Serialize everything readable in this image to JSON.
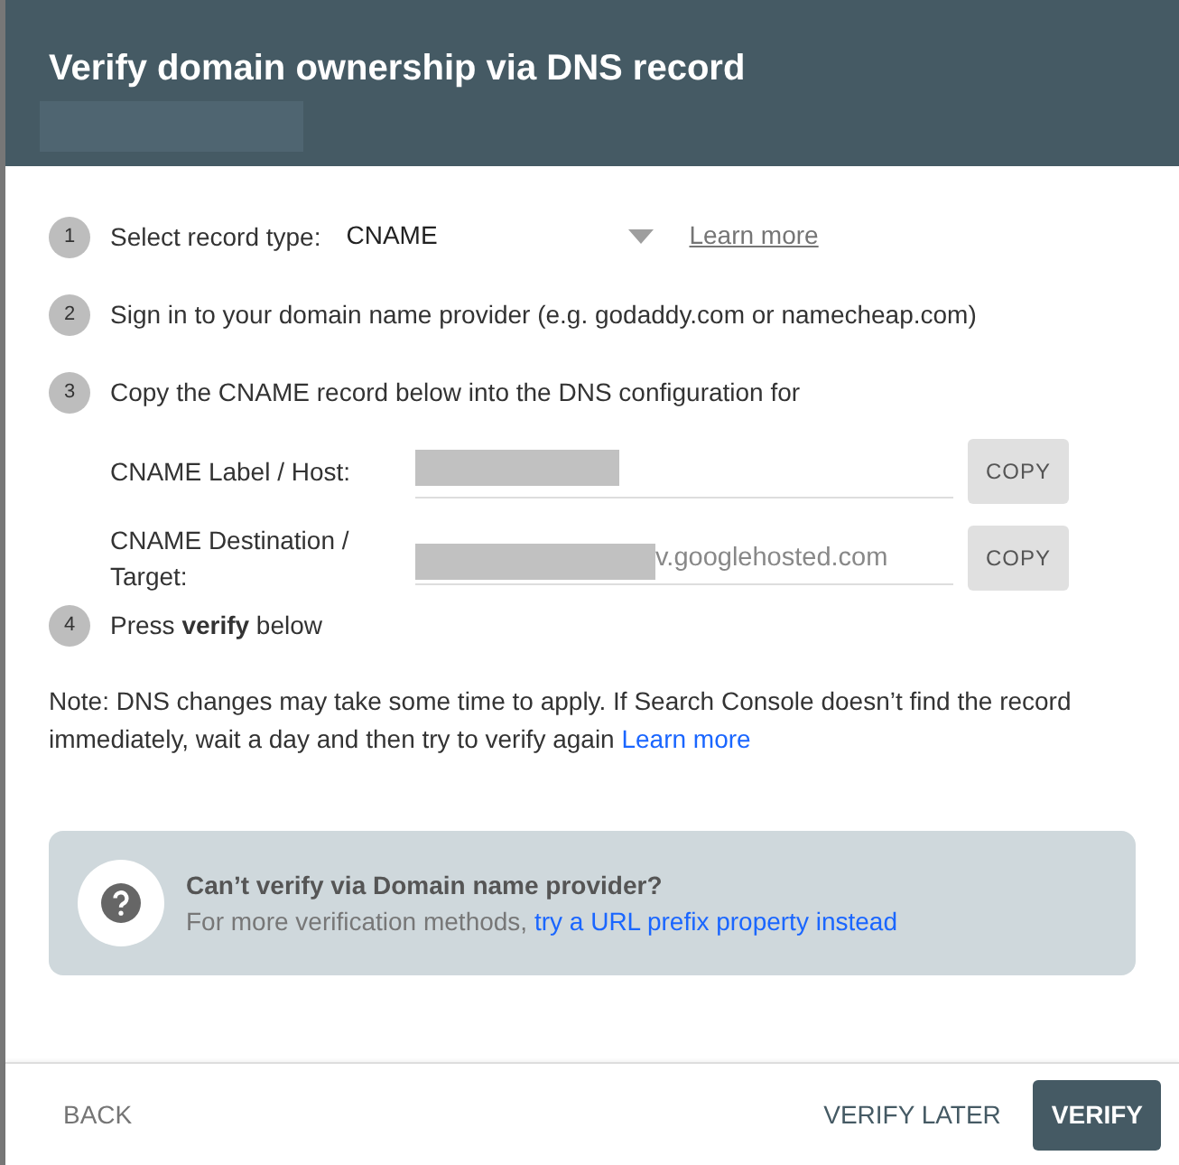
{
  "dialog": {
    "title": "Verify domain ownership via DNS record"
  },
  "steps": [
    {
      "kind": "select",
      "number": "1",
      "label": "Select record type:",
      "value": "CNAME",
      "link": "Learn more"
    },
    {
      "kind": "text",
      "number": "2",
      "text": "Sign in to your domain name provider (e.g. godaddy.com or namecheap.com)"
    },
    {
      "kind": "fields",
      "number": "3",
      "text": "Copy the CNAME record below into the DNS configuration for",
      "fields": [
        {
          "label": "CNAME Label / Host:",
          "button": "COPY"
        },
        {
          "label": "CNAME Destination / Target:",
          "value": "v.googlehosted.com",
          "button": "COPY"
        }
      ]
    },
    {
      "kind": "text",
      "number": "4",
      "text": "Press **verify** below"
    }
  ],
  "note": {
    "text": "Note: DNS changes may take some time to apply. If Search Console doesn’t find the record immediately, wait a day and then try to verify again",
    "link": "Learn more"
  },
  "info_box": {
    "title": "Can’t verify via Domain name provider?",
    "text": "For more verification methods,",
    "link": "try a URL prefix property instead"
  },
  "footer": {
    "back": "BACK",
    "buttons": [
      {
        "label": "VERIFY LATER",
        "primary": false
      },
      {
        "label": "VERIFY",
        "primary": true
      }
    ]
  }
}
